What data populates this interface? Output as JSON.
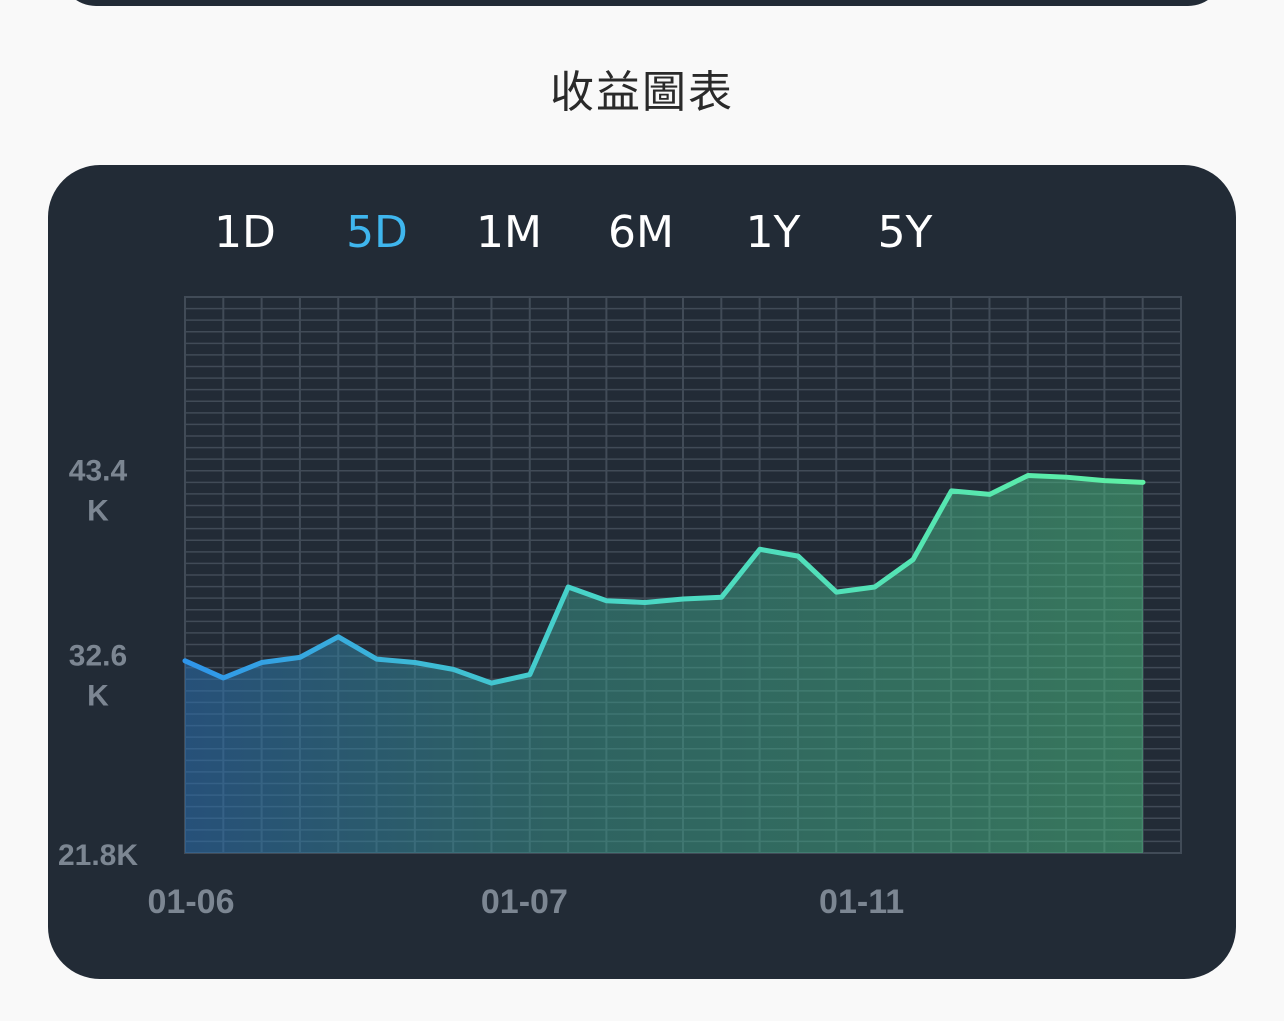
{
  "page": {
    "title": "收益圖表"
  },
  "tabs": [
    {
      "label": "1D",
      "active": false
    },
    {
      "label": "5D",
      "active": true
    },
    {
      "label": "1M",
      "active": false
    },
    {
      "label": "6M",
      "active": false
    },
    {
      "label": "1Y",
      "active": false
    },
    {
      "label": "5Y",
      "active": false
    }
  ],
  "colors": {
    "card_bg": "#222b36",
    "active_tab": "#3fb6ee",
    "line_start": "#2f95ea",
    "line_end": "#5ef0a4",
    "axis_text": "#7c8692",
    "grid": "#414b57"
  },
  "chart_data": {
    "type": "area",
    "ytick_labels": [
      [
        "43.4",
        "K"
      ],
      [
        "32.6",
        "K"
      ],
      [
        "21.8K"
      ]
    ],
    "yticks": [
      43.4,
      32.6,
      21.8
    ],
    "ylim": [
      21.8,
      54.2
    ],
    "xtick_labels": [
      "01-06",
      "01-07",
      "01-11"
    ],
    "xtick_positions": [
      0,
      8.7,
      17.5
    ],
    "xlim": [
      0,
      25
    ],
    "grid": true,
    "x": [
      0,
      1,
      2,
      3,
      4,
      5,
      6,
      7,
      8,
      9,
      10,
      11,
      12,
      13,
      14,
      15,
      16,
      17,
      18,
      19,
      20,
      21,
      22,
      23,
      24,
      25
    ],
    "values": [
      33.0,
      32.0,
      32.9,
      33.2,
      34.4,
      33.1,
      32.9,
      32.5,
      31.7,
      32.2,
      37.3,
      36.5,
      36.4,
      36.6,
      36.7,
      39.5,
      39.1,
      37.0,
      37.3,
      38.9,
      42.9,
      42.7,
      43.8,
      43.7,
      43.5,
      43.4
    ]
  }
}
